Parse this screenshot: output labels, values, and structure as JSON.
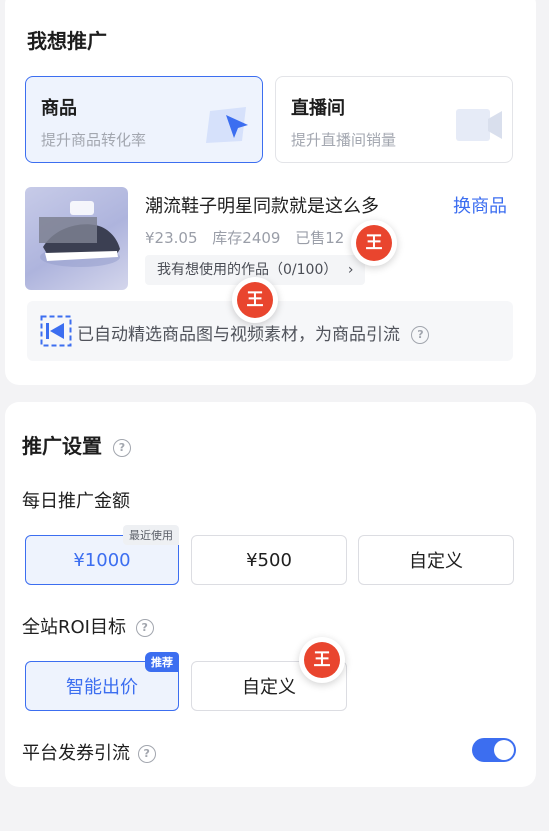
{
  "promo": {
    "title": "我想推广",
    "types": [
      {
        "title": "商品",
        "subtitle": "提升商品转化率",
        "selected": true,
        "icon": "cursor-arrow-icon"
      },
      {
        "title": "直播间",
        "subtitle": "提升直播间销量",
        "selected": false,
        "icon": "live-camera-icon"
      }
    ],
    "product": {
      "title": "潮流鞋子明星同款就是这么多",
      "swap_label": "换商品",
      "price": "¥23.05",
      "stock": "库存2409",
      "sold": "已售12",
      "works_label": "我有想使用的作品（0/100）",
      "works_arrow": "›"
    },
    "notice": "已自动精选商品图与视频素材，为商品引流"
  },
  "settings": {
    "title": "推广设置",
    "daily_budget_label": "每日推广金额",
    "budget_options": [
      {
        "label": "¥1000",
        "selected": true,
        "tag": "最近使用"
      },
      {
        "label": "¥500",
        "selected": false
      },
      {
        "label": "自定义",
        "selected": false
      }
    ],
    "roi_label": "全站ROI目标",
    "roi_options": [
      {
        "label": "智能出价",
        "selected": true,
        "tag": "推荐"
      },
      {
        "label": "自定义",
        "selected": false
      }
    ],
    "coupon_label": "平台发券引流",
    "coupon_enabled": true
  },
  "overlay": {
    "avatar_char": "王"
  },
  "colors": {
    "accent": "#3c6ef0",
    "avatar": "#e9452e"
  }
}
